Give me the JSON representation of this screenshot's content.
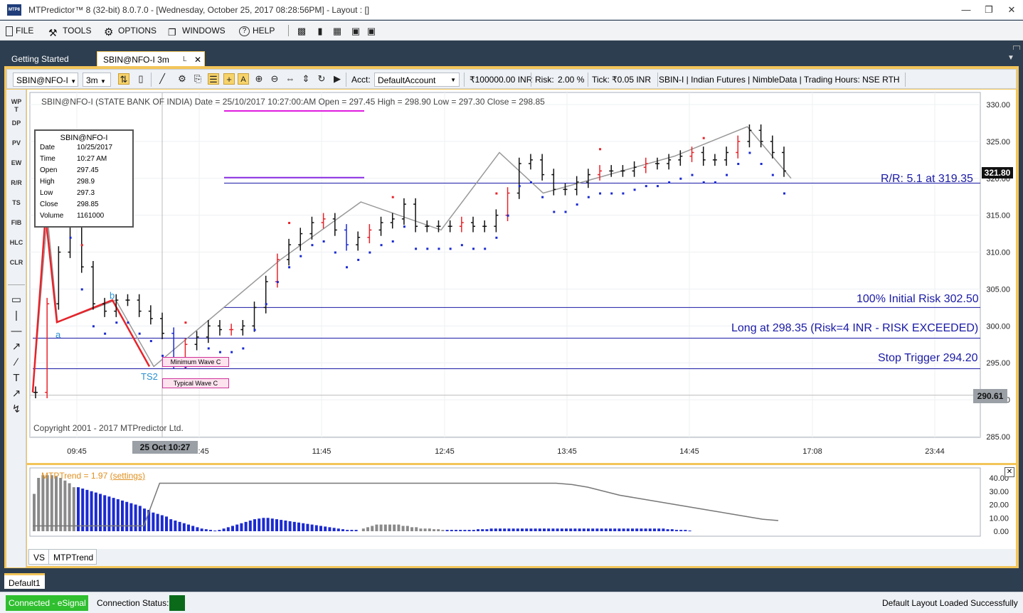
{
  "window": {
    "title": "MTPredictor™ 8 (32-bit) 8.0.7.0 - [Wednesday, October 25, 2017 08:28:56PM]  - Layout : []",
    "app_icon_text": "MTP8"
  },
  "menu": {
    "file": "FILE",
    "tools": "TOOLS",
    "options": "OPTIONS",
    "windows": "WINDOWS",
    "help": "HELP"
  },
  "doc_tabs": {
    "getting_started": "Getting Started",
    "active_tab": "SBIN@NFO-I 3m"
  },
  "toolbar": {
    "symbol": "SBIN@NFO-I",
    "interval": "3m",
    "acct_label": "Acct:",
    "account": "DefaultAccount",
    "capital": "₹100000.00 INR",
    "risk_label": "Risk:",
    "risk_value": "2.00 %",
    "tick_label": "Tick:",
    "tick_value": "₹0.05 INR",
    "info": "SBIN-I | Indian Futures | NimbleData | Trading Hours: NSE RTH"
  },
  "left_tools": [
    "WP\nT",
    "DP",
    "PV",
    "EW",
    "R/R",
    "TS",
    "FIB",
    "HLC",
    "CLR"
  ],
  "chart_header": "SBIN@NFO-I (STATE BANK OF INDIA) Date = 25/10/2017 10:27:00:AM Open = 297.45 High = 298.90 Low = 297.30 Close = 298.85",
  "data_window": {
    "title": "SBIN@NFO-I",
    "rows": [
      {
        "label": "Date",
        "value": "10/25/2017"
      },
      {
        "label": "Time",
        "value": "10:27 AM"
      },
      {
        "label": "Open",
        "value": "297.45"
      },
      {
        "label": "High",
        "value": "298.9"
      },
      {
        "label": "Low",
        "value": "297.3"
      },
      {
        "label": "Close",
        "value": "298.85"
      },
      {
        "label": "Volume",
        "value": "1161000"
      }
    ]
  },
  "annotations": {
    "rr": "R/R: 5.1 at 319.35",
    "initial_risk": "100% Initial Risk 302.50",
    "long": "Long at 298.35 (Risk=4 INR - RISK EXCEEDED)",
    "stop": "Stop Trigger 294.20",
    "min_wave_c": "Minimum Wave C",
    "typical_wave_c": "Typical Wave C",
    "label_a": "a",
    "label_b": "b",
    "label_ts2": "TS2",
    "copyright": "Copyright 2001 - 2017 MTPredictor Ltd.",
    "cursor_time": "25 Oct 10:27",
    "last_price": "321.80",
    "cursor_price": "290.61"
  },
  "indicator": {
    "label": "MTPTrend = 1.97",
    "settings": "(settings)"
  },
  "bottom_tabs": [
    "VS",
    "MTPTrend"
  ],
  "layout_tab": "Default1",
  "status": {
    "connected": "Connected - eSignal",
    "connection_label": "Connection Status:",
    "message": "Default Layout Loaded Successfully"
  },
  "colors": {
    "frame": "#f3c55a",
    "dark_bg": "#2d3e50",
    "up_bar": "#e8232a",
    "down_bar": "#1b2ad1",
    "trend_line": "#1a1aa6",
    "connected_green": "#2fbf2f"
  },
  "chart_data": {
    "type": "line",
    "title": "SBIN@NFO-I (STATE BANK OF INDIA)",
    "x_tick_labels": [
      "09:45",
      "10:45",
      "11:45",
      "12:45",
      "13:45",
      "14:45",
      "17:08",
      "23:44"
    ],
    "y_tick_labels": [
      "285.00",
      "290.00",
      "295.00",
      "300.00",
      "305.00",
      "310.00",
      "315.00",
      "320.00",
      "325.00",
      "330.00"
    ],
    "ylim": [
      284,
      331
    ],
    "levels": [
      {
        "name": "R/R: 5.1 at 319.35",
        "value": 319.35
      },
      {
        "name": "100% Initial Risk 302.50",
        "value": 302.5
      },
      {
        "name": "Long at 298.35",
        "value": 298.35
      },
      {
        "name": "Stop Trigger 294.20",
        "value": 294.2
      }
    ],
    "swing_path": [
      [
        0,
        291
      ],
      [
        10,
        315
      ],
      [
        17,
        300.5
      ],
      [
        57,
        303.5
      ],
      [
        83,
        294.5
      ],
      [
        170,
        309
      ],
      [
        225,
        316.8
      ],
      [
        280,
        313
      ],
      [
        320,
        323.5
      ],
      [
        350,
        318
      ],
      [
        440,
        323
      ],
      [
        490,
        327
      ],
      [
        520,
        320
      ]
    ],
    "close_series": [
      291,
      303,
      310,
      315,
      308,
      303,
      302,
      303.5,
      303.5,
      302,
      301,
      299,
      295,
      297.5,
      298.5,
      300,
      299.5,
      299.5,
      300,
      302.5,
      306,
      309,
      311,
      312.5,
      314,
      314.5,
      313,
      311,
      312,
      313,
      314,
      314.5,
      316.5,
      313.5,
      313.5,
      313.5,
      313.5,
      314,
      313.5,
      313.5,
      315,
      318,
      322,
      322.5,
      320.5,
      318.5,
      318.5,
      319.5,
      320.5,
      321,
      321,
      321,
      321.5,
      322,
      322,
      322.5,
      323,
      323.5,
      322.5,
      322.5,
      323.5,
      325,
      326.5,
      325,
      323.5,
      321
    ]
  },
  "indicator_data": {
    "type": "bar",
    "y_tick_labels": [
      "0.00",
      "10.00",
      "20.00",
      "30.00",
      "40.00"
    ],
    "ylim": [
      -2,
      44
    ],
    "gray_bars": [
      28,
      40,
      42,
      42,
      42,
      41,
      40,
      38,
      36,
      33
    ],
    "blue_bars": [
      33,
      32,
      31,
      30,
      29,
      28,
      27,
      26,
      25,
      24,
      23,
      22,
      21,
      20,
      19,
      17,
      16,
      14,
      13,
      12,
      11,
      9,
      8,
      7,
      6,
      5,
      4,
      3,
      2,
      1.5,
      1,
      0.5,
      1,
      2,
      3,
      4,
      5,
      6,
      7,
      8,
      9,
      9.5,
      10,
      10,
      9.5,
      9,
      8.5,
      8,
      7.5,
      7,
      6.5,
      6,
      5.5,
      5,
      4.5,
      4,
      3.5,
      3,
      2.5,
      2,
      1.5,
      1,
      1,
      1
    ],
    "tail_gray_bars": [
      2,
      3,
      4,
      5,
      5,
      5,
      5,
      5,
      5,
      4,
      4,
      3,
      3,
      2,
      2,
      2,
      1.5,
      1.5,
      1
    ],
    "tail_blue_bars": [
      1,
      1,
      1,
      1,
      1,
      1,
      1,
      1.5,
      1.5,
      1.5,
      2,
      2,
      2,
      2,
      2,
      2,
      2,
      2,
      2,
      2,
      2,
      2,
      2,
      2,
      2,
      2,
      2,
      2,
      2,
      2,
      2,
      2,
      2,
      2,
      2,
      2,
      2,
      2,
      2,
      2,
      2,
      2,
      2,
      2,
      2,
      2,
      2,
      2,
      2,
      2,
      1.5,
      1.5,
      1,
      1,
      1,
      0.5
    ],
    "trend_line": [
      4,
      4,
      4,
      4,
      4,
      4,
      4,
      4,
      36,
      36,
      36,
      36,
      36,
      36,
      36,
      36,
      36,
      36,
      36,
      36,
      36,
      36,
      36,
      36,
      36,
      36,
      36,
      36,
      36,
      36,
      36,
      36,
      36,
      36,
      35,
      33,
      30,
      27,
      25,
      23,
      21,
      19,
      17,
      15,
      13,
      11,
      9,
      8
    ]
  }
}
